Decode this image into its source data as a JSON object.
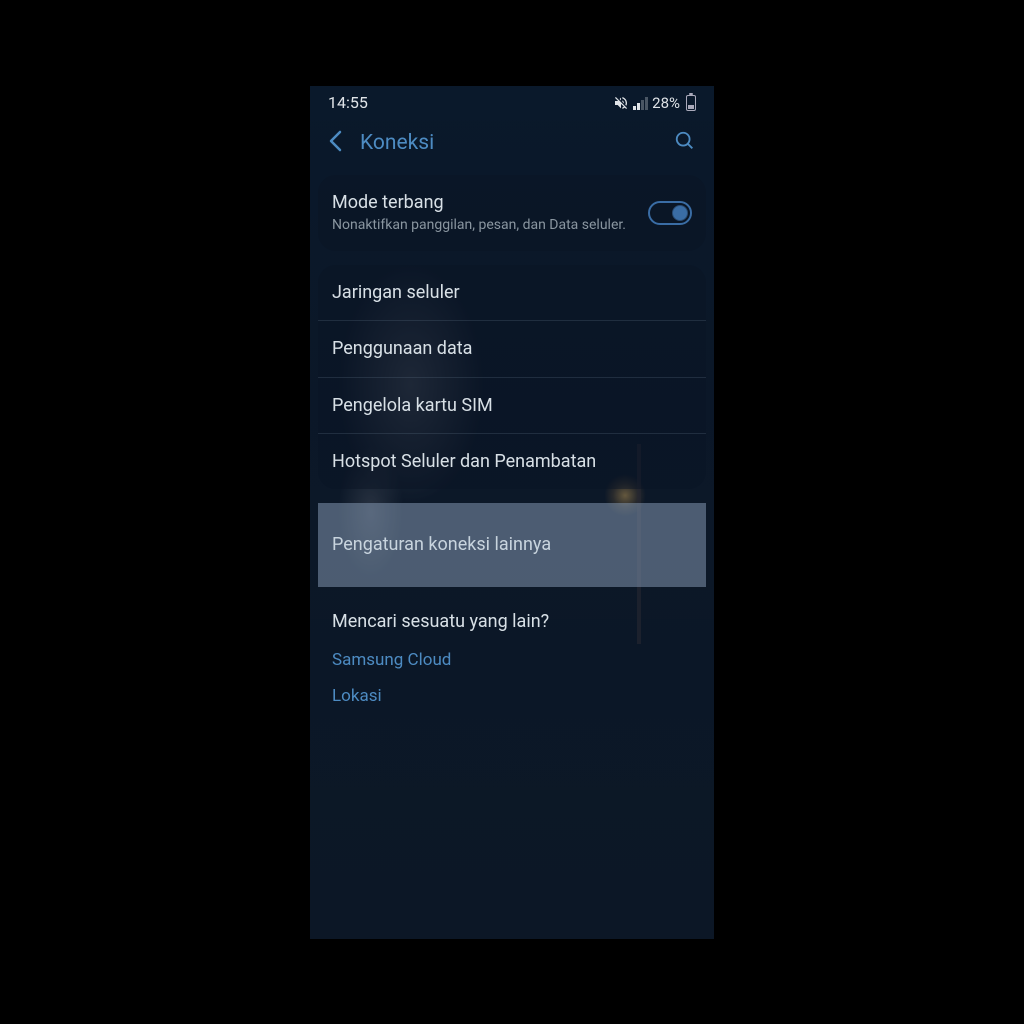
{
  "status": {
    "time": "14:55",
    "battery": "28%"
  },
  "header": {
    "title": "Koneksi"
  },
  "airplane": {
    "title": "Mode terbang",
    "subtitle": "Nonaktifkan panggilan, pesan, dan Data seluler.",
    "enabled": true
  },
  "group2": {
    "items": [
      {
        "label": "Jaringan seluler"
      },
      {
        "label": "Penggunaan data"
      },
      {
        "label": "Pengelola kartu SIM"
      },
      {
        "label": "Hotspot Seluler dan Penambatan"
      }
    ]
  },
  "highlighted": {
    "label": "Pengaturan koneksi lainnya"
  },
  "footer": {
    "heading": "Mencari sesuatu yang lain?",
    "links": [
      "Samsung Cloud",
      "Lokasi"
    ]
  }
}
